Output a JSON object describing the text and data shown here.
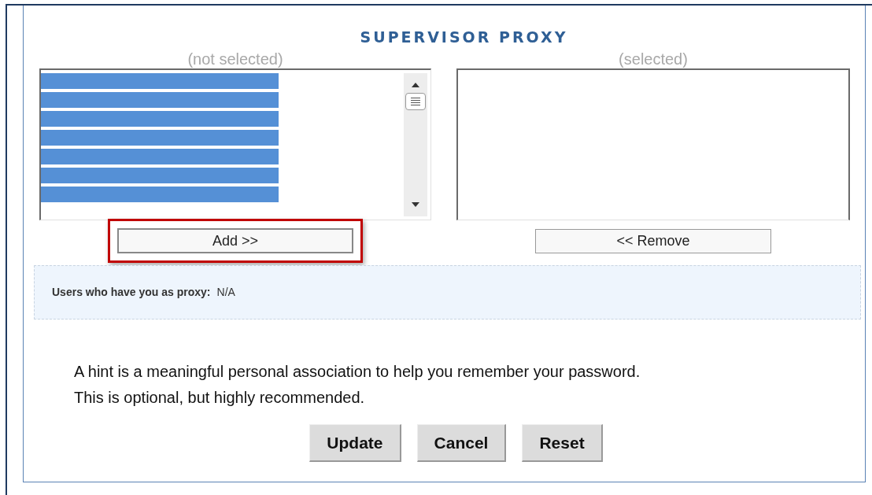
{
  "section": {
    "title": "SUPERVISOR PROXY"
  },
  "available_list": {
    "caption": "(not selected)",
    "items": [
      {
        "selected": true
      },
      {
        "selected": true
      },
      {
        "selected": true
      },
      {
        "selected": true
      },
      {
        "selected": true
      },
      {
        "selected": true
      },
      {
        "selected": true
      }
    ]
  },
  "selected_list": {
    "caption": "(selected)"
  },
  "add_button": {
    "label": "Add >>",
    "highlighted": true
  },
  "remove_button": {
    "label": "<< Remove"
  },
  "proxy_info": {
    "label": "Users who have you as proxy:",
    "value": "N/A"
  },
  "hint": {
    "lines": [
      "A hint is a meaningful personal association to help you remember your password.",
      "This is optional, but highly recommended."
    ]
  },
  "buttons": [
    "Update",
    "Cancel",
    "Reset"
  ]
}
